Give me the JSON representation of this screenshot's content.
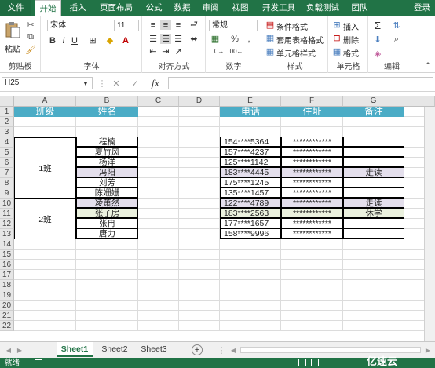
{
  "ribbon_tabs": [
    "文件",
    "开始",
    "插入",
    "页面布局",
    "公式",
    "数据",
    "审阅",
    "视图",
    "开发工具",
    "负载测试",
    "团队"
  ],
  "login": "登录",
  "ribbon": {
    "paste": "粘贴",
    "clipboard": "剪贴板",
    "font_name": "宋体",
    "font_size": "11",
    "font_group": "字体",
    "align_group": "对齐方式",
    "number_format": "常规",
    "percent": "%",
    "comma": ",",
    "number_group": "数字",
    "cond_format": "条件格式",
    "table_format": "套用表格格式",
    "cell_style": "单元格样式",
    "styles_group": "样式",
    "insert": "插入",
    "delete": "删除",
    "format": "格式",
    "cells_group": "单元格",
    "editing_group": "编辑"
  },
  "name_box": "H25",
  "fx": "fx",
  "columns": [
    "A",
    "B",
    "C",
    "D",
    "E",
    "F",
    "G"
  ],
  "rows": [
    "1",
    "2",
    "3",
    "4",
    "5",
    "6",
    "7",
    "8",
    "9",
    "10",
    "11",
    "12",
    "13",
    "14",
    "15",
    "16",
    "17",
    "18",
    "19",
    "20",
    "21",
    "22"
  ],
  "headers": {
    "class": "班级",
    "name": "姓名",
    "phone": "电话",
    "address": "住址",
    "note": "备注"
  },
  "classes": [
    "1班",
    "2班"
  ],
  "students": [
    {
      "name": "程楠",
      "phone": "154****5364",
      "addr": "************",
      "note": ""
    },
    {
      "name": "夏竹风",
      "phone": "157****4237",
      "addr": "************",
      "note": ""
    },
    {
      "name": "杨洋",
      "phone": "125****1142",
      "addr": "************",
      "note": ""
    },
    {
      "name": "冯阳",
      "phone": "183****4445",
      "addr": "************",
      "note": "走读"
    },
    {
      "name": "刘芳",
      "phone": "175****1245",
      "addr": "************",
      "note": ""
    },
    {
      "name": "陈姗姗",
      "phone": "135****1457",
      "addr": "************",
      "note": ""
    },
    {
      "name": "凌萧然",
      "phone": "122****4789",
      "addr": "************",
      "note": "走读"
    },
    {
      "name": "张子房",
      "phone": "183****2563",
      "addr": "************",
      "note": "休学"
    },
    {
      "name": "张冉",
      "phone": "177****1657",
      "addr": "************",
      "note": ""
    },
    {
      "name": "唐力",
      "phone": "158****9996",
      "addr": "************",
      "note": ""
    }
  ],
  "sheets": [
    "Sheet1",
    "Sheet2",
    "Sheet3"
  ],
  "status": "就绪",
  "watermark": "亿速云"
}
